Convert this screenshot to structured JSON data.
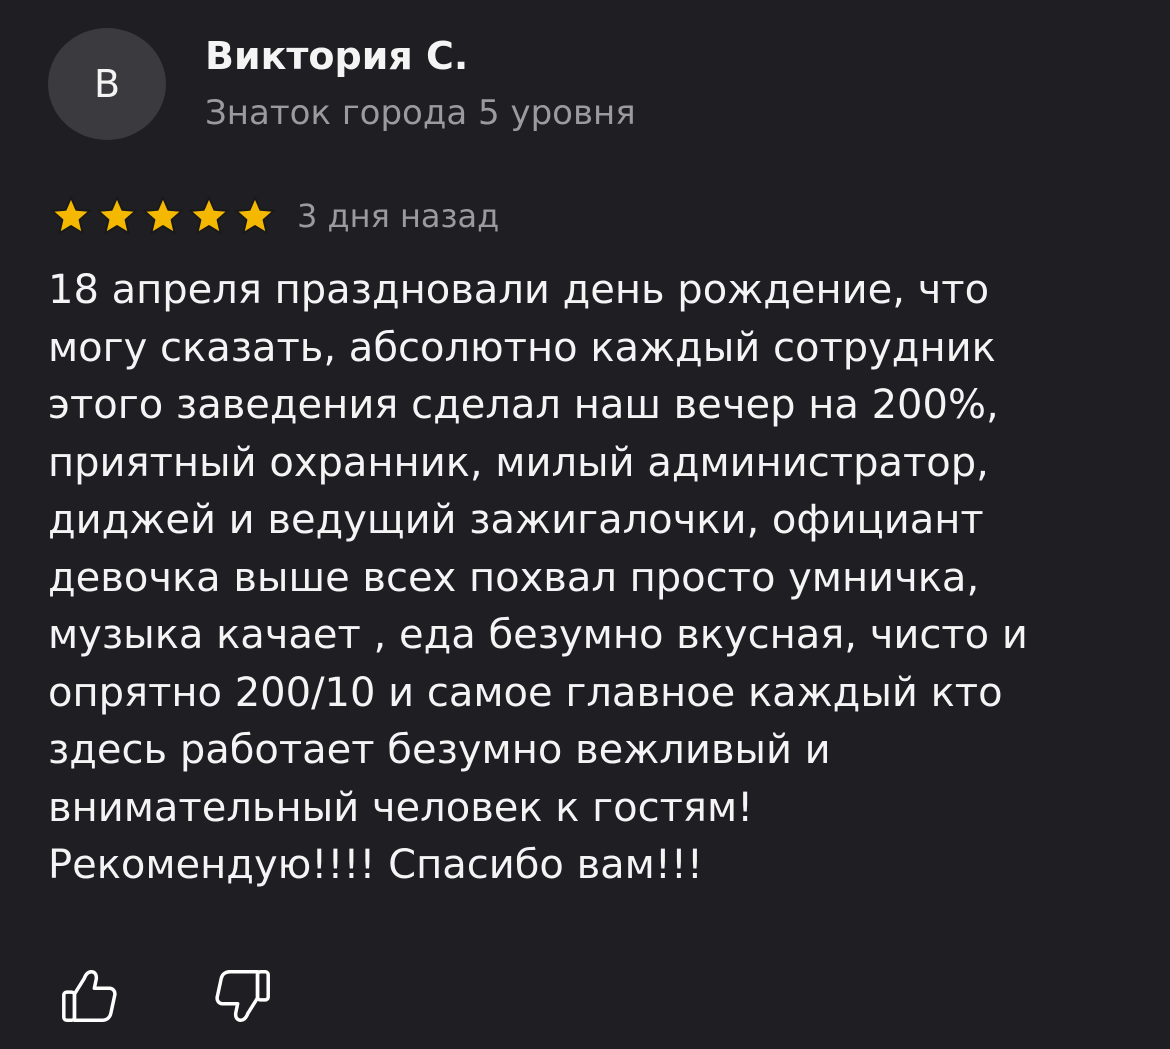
{
  "author": {
    "avatar_letter": "В",
    "name": "Виктория С.",
    "level": "Знаток города 5 уровня"
  },
  "review": {
    "rating": 5,
    "rating_max": 5,
    "date": "3 дня назад",
    "star_color": "#f5b800",
    "lines": [
      "18 апреля праздновали день рождение, что",
      "могу сказать, абсолютно каждый сотрудник",
      "этого заведения сделал наш вечер на 200%,",
      "приятный охранник, милый администратор,",
      "диджей и ведущий зажигалочки, официант",
      "девочка выше всех похвал просто умничка,",
      "музыка качает , еда безумно вкусная, чисто и",
      "опрятно 200/10 и самое главное каждый кто",
      "здесь работает безумно вежливый и",
      "внимательный человек к гостям!",
      "Рекомендую!!!! Спасибо вам!!!"
    ]
  },
  "actions": {
    "like_icon": "thumbs-up-icon",
    "dislike_icon": "thumbs-down-icon"
  },
  "colors": {
    "background": "#1e1e23",
    "avatar_bg": "#3a3a3f",
    "primary_text": "#f4f4f4",
    "secondary_text": "#9a9a9f"
  }
}
